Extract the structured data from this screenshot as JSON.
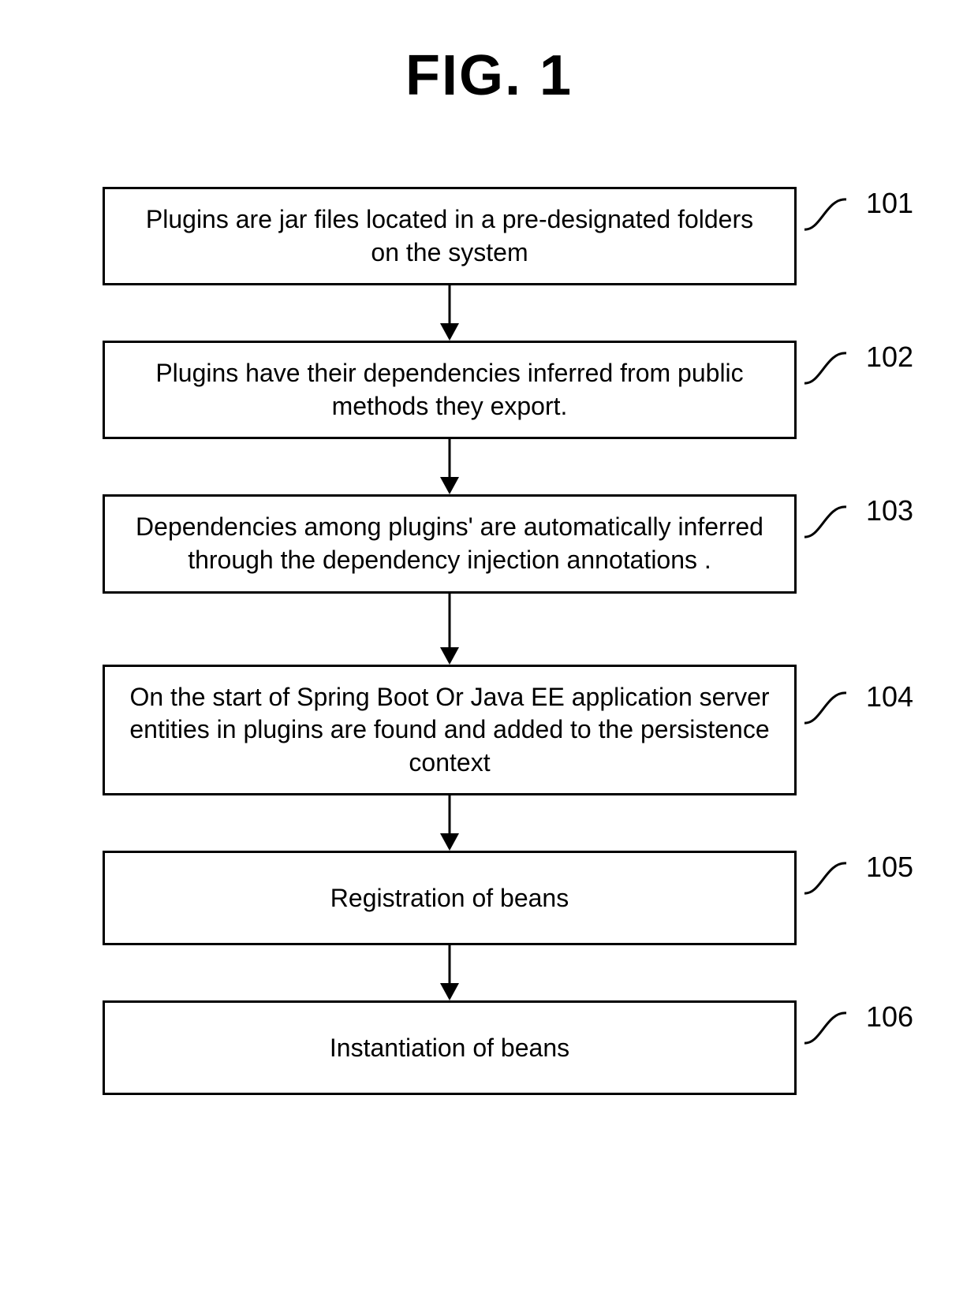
{
  "title": "FIG. 1",
  "steps": [
    {
      "num": "101",
      "text": "Plugins are jar files located in a pre-designated folders on the system"
    },
    {
      "num": "102",
      "text": "Plugins have their dependencies inferred from public methods they export."
    },
    {
      "num": "103",
      "text": "Dependencies among plugins' are automatically inferred through the dependency injection annotations ."
    },
    {
      "num": "104",
      "text": "On the start of Spring Boot Or Java EE application server entities in plugins are found and added to the persistence context"
    },
    {
      "num": "105",
      "text": "Registration of beans"
    },
    {
      "num": "106",
      "text": "Instantiation of beans"
    }
  ]
}
